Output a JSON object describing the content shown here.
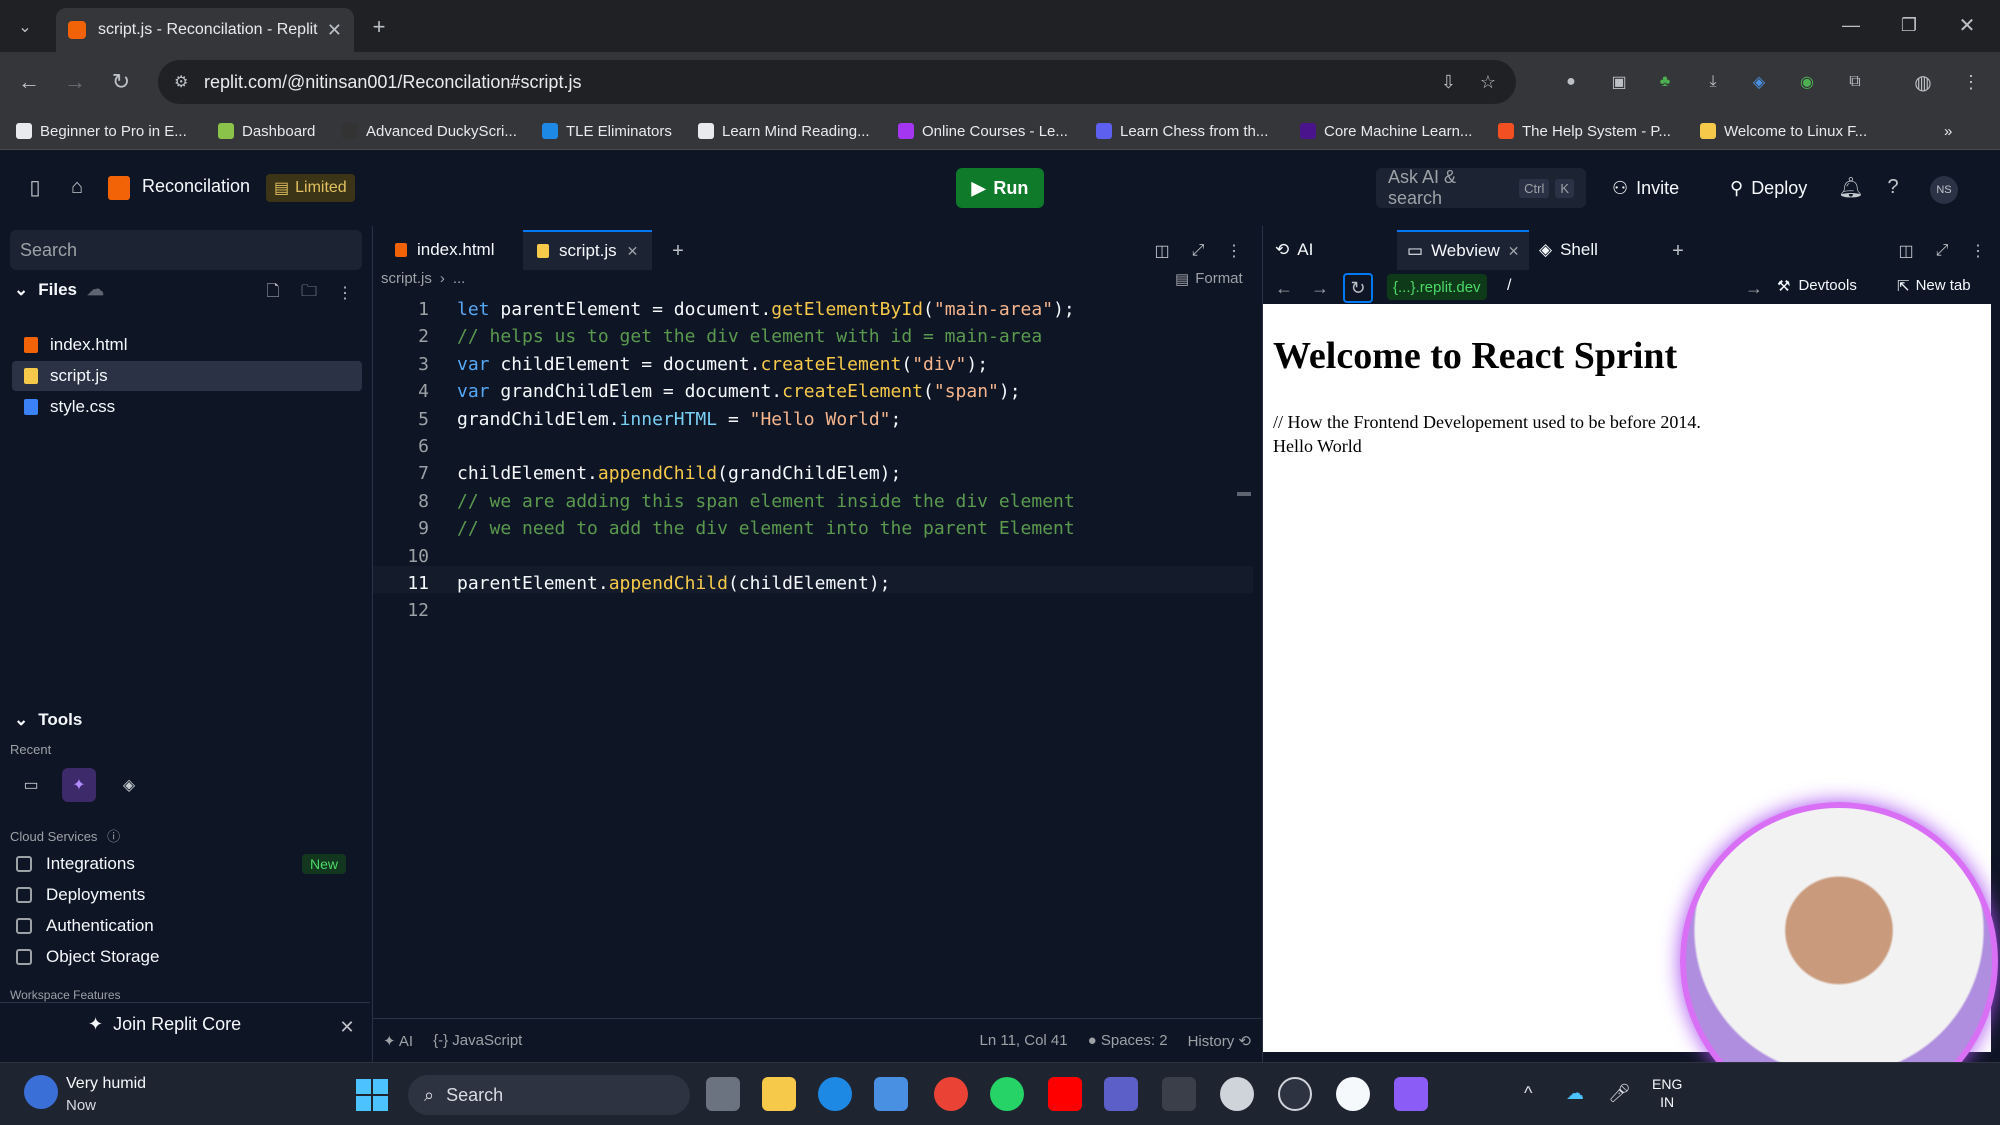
{
  "browser": {
    "tab_title": "script.js - Reconcilation - Replit",
    "url": "replit.com/@nitinsan001/Reconcilation#script.js",
    "bookmarks": [
      {
        "label": "Beginner to Pro in E...",
        "color": "#e8eaed"
      },
      {
        "label": "Dashboard",
        "color": "#8bc34a"
      },
      {
        "label": "Advanced DuckyScri...",
        "color": "#333333"
      },
      {
        "label": "TLE Eliminators",
        "color": "#1e88e5"
      },
      {
        "label": "Learn Mind Reading...",
        "color": "#e8eaed"
      },
      {
        "label": "Online Courses - Le...",
        "color": "#a435f0"
      },
      {
        "label": "Learn Chess from th...",
        "color": "#5d5fef"
      },
      {
        "label": "Core Machine Learn...",
        "color": "#4a148c"
      },
      {
        "label": "The Help System - P...",
        "color": "#f25022"
      },
      {
        "label": "Welcome to Linux F...",
        "color": "#f6c94a"
      }
    ]
  },
  "header": {
    "project_name": "Reconcilation",
    "plan_badge": "Limited",
    "run_label": "Run",
    "ask_ai_placeholder": "Ask AI & search",
    "shortcut_ctrl": "Ctrl",
    "shortcut_key": "K",
    "invite_label": "Invite",
    "deploy_label": "Deploy",
    "user_initials": "NS"
  },
  "sidebar": {
    "search_placeholder": "Search",
    "files_title": "Files",
    "files": [
      {
        "name": "index.html",
        "color": "#f26207"
      },
      {
        "name": "script.js",
        "color": "#f6c94a"
      },
      {
        "name": "style.css",
        "color": "#3b82f6"
      }
    ],
    "tools_title": "Tools",
    "recent_label": "Recent",
    "cloud_services_label": "Cloud Services",
    "cloud_items": [
      {
        "label": "Integrations",
        "badge": "New"
      },
      {
        "label": "Deployments",
        "badge": ""
      },
      {
        "label": "Authentication",
        "badge": ""
      },
      {
        "label": "Object Storage",
        "badge": ""
      }
    ],
    "workspace_features_label": "Workspace Features",
    "join_core_label": "Join Replit Core"
  },
  "editor": {
    "tabs": [
      "index.html",
      "script.js"
    ],
    "breadcrumb_file": "script.js",
    "breadcrumb_rest": "...",
    "format_label": "Format",
    "line_numbers": [
      "1",
      "2",
      "3",
      "4",
      "5",
      "6",
      "7",
      "8",
      "9",
      "10",
      "11",
      "12"
    ],
    "status": {
      "ai": "AI",
      "language": "JavaScript",
      "position": "Ln 11, Col 41",
      "spaces": "Spaces: 2",
      "history": "History"
    }
  },
  "code_lines": [
    [
      {
        "t": "let ",
        "c": "kw"
      },
      {
        "t": "parentElement = document.",
        "c": ""
      },
      {
        "t": "getElementById",
        "c": "fn"
      },
      {
        "t": "(",
        "c": ""
      },
      {
        "t": "\"main-area\"",
        "c": "st"
      },
      {
        "t": ");",
        "c": ""
      }
    ],
    [
      {
        "t": "// helps us to get the div element with id = main-area",
        "c": "cm"
      }
    ],
    [
      {
        "t": "var ",
        "c": "kw"
      },
      {
        "t": "childElement = document.",
        "c": ""
      },
      {
        "t": "createElement",
        "c": "fn"
      },
      {
        "t": "(",
        "c": ""
      },
      {
        "t": "\"div\"",
        "c": "st"
      },
      {
        "t": ");",
        "c": ""
      }
    ],
    [
      {
        "t": "var ",
        "c": "kw"
      },
      {
        "t": "grandChildElem = document.",
        "c": ""
      },
      {
        "t": "createElement",
        "c": "fn"
      },
      {
        "t": "(",
        "c": ""
      },
      {
        "t": "\"span\"",
        "c": "st"
      },
      {
        "t": ");",
        "c": ""
      }
    ],
    [
      {
        "t": "grandChildElem.",
        "c": ""
      },
      {
        "t": "innerHTML",
        "c": "pr"
      },
      {
        "t": " = ",
        "c": ""
      },
      {
        "t": "\"Hello World\"",
        "c": "st"
      },
      {
        "t": ";",
        "c": ""
      }
    ],
    [],
    [
      {
        "t": "childElement.",
        "c": ""
      },
      {
        "t": "appendChild",
        "c": "fn"
      },
      {
        "t": "(grandChildElem);",
        "c": ""
      }
    ],
    [
      {
        "t": "// we are adding this span element inside the div element",
        "c": "cm"
      }
    ],
    [
      {
        "t": "// we need to add the div element into the parent Element",
        "c": "cm"
      }
    ],
    [],
    [
      {
        "t": "parentElement.",
        "c": ""
      },
      {
        "t": "appendChild",
        "c": "fn"
      },
      {
        "t": "(childElement);",
        "c": ""
      }
    ],
    []
  ],
  "rightpane": {
    "tabs": [
      "AI",
      "Webview",
      "Shell"
    ],
    "url_chip": "{...}.replit.dev",
    "url_path": "/",
    "devtools_label": "Devtools",
    "new_tab_label": "New tab",
    "page_heading": "Welcome to React Sprint",
    "page_line1": "// How the Frontend Developement used to be before 2014.",
    "page_line2": "Hello World"
  },
  "taskbar": {
    "weather_title": "Very humid",
    "weather_sub": "Now",
    "search_label": "Search",
    "lang_top": "ENG",
    "lang_bottom": "IN"
  }
}
